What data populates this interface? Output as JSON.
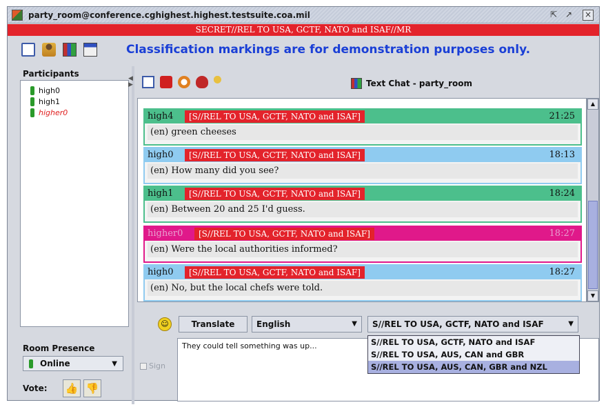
{
  "window": {
    "title": "party_room@conference.cghighest.highest.testsuite.coa.mil",
    "controls": [
      "restore-icon",
      "maximize-icon",
      "close-icon"
    ]
  },
  "banner": {
    "text": "SECRET//REL TO USA, GCTF, NATO and ISAF//MR",
    "color": "#e3232b"
  },
  "demo_note": "Classification markings are for demonstration purposes only.",
  "participants": {
    "title": "Participants",
    "items": [
      {
        "name": "high0",
        "status": "online"
      },
      {
        "name": "high1",
        "status": "online"
      },
      {
        "name": "higher0",
        "status": "away"
      }
    ]
  },
  "presence": {
    "title": "Room Presence",
    "value": "Online"
  },
  "vote": {
    "label": "Vote:"
  },
  "chat": {
    "title": "Text Chat - party_room",
    "messages": [
      {
        "sender": "high4",
        "classification": "[S//REL TO USA, GCTF, NATO and ISAF]",
        "time": "21:25",
        "text": "(en) green cheeses",
        "color": "#4cbf8c"
      },
      {
        "sender": "high0",
        "classification": "[S//REL TO USA, GCTF, NATO and ISAF]",
        "time": "18:13",
        "text": "(en) How many did you see?",
        "color": "#8fcbf0"
      },
      {
        "sender": "high1",
        "classification": "[S//REL TO USA, GCTF, NATO and ISAF]",
        "time": "18:24",
        "text": "(en) Between 20 and 25 I'd guess.",
        "color": "#4cbf8c"
      },
      {
        "sender": "higher0",
        "classification": "[S//REL TO USA, GCTF, NATO and ISAF]",
        "time": "18:27",
        "text": "(en) Were the local authorities informed?",
        "color": "#e0198a"
      },
      {
        "sender": "high0",
        "classification": "[S//REL TO USA, GCTF, NATO and ISAF]",
        "time": "18:27",
        "text": "(en) No, but the local chefs were told.",
        "color": "#8fcbf0"
      }
    ]
  },
  "compose": {
    "translate_label": "Translate",
    "language": "English",
    "classification": "S//REL TO USA, GCTF, NATO and ISAF",
    "input_value": "They could tell something was up...",
    "sign_label": "Sign",
    "classification_options": [
      "S//REL TO USA, GCTF, NATO and ISAF",
      "S//REL TO USA, AUS, CAN and GBR",
      "S//REL TO USA, AUS, CAN, GBR and NZL"
    ],
    "highlighted_option": "S//REL TO USA, AUS, CAN, GBR and NZL"
  }
}
